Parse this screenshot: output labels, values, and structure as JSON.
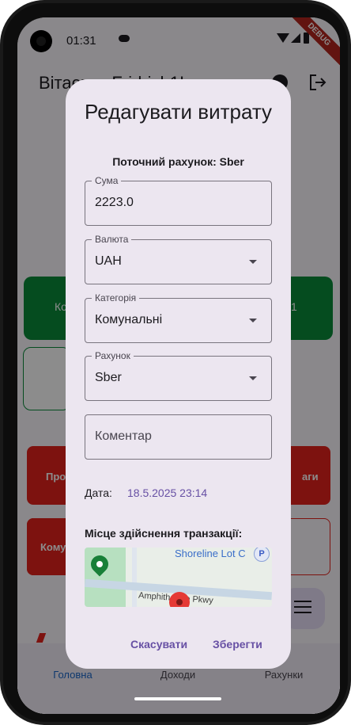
{
  "status_bar": {
    "time": "01:31",
    "debug_label": "DEBUG"
  },
  "app": {
    "title": "Вітаємо, Fridrich1!",
    "green_card": {
      "left_text": "Ко",
      "right_text": "1"
    },
    "red_card_1": {
      "left_text": "Про",
      "right_text": "аги"
    },
    "red_card_2": {
      "left_text": "Кому"
    }
  },
  "bottom_nav": {
    "items": [
      {
        "label": "Головна",
        "active": true
      },
      {
        "label": "Доходи",
        "active": false
      },
      {
        "label": "Рахунки",
        "active": false
      }
    ]
  },
  "dialog": {
    "title": "Редагувати витрату",
    "current_account": "Поточний рахунок: Sber",
    "fields": {
      "amount": {
        "label": "Сума",
        "value": "2223.0"
      },
      "currency": {
        "label": "Валюта",
        "value": "UAH"
      },
      "category": {
        "label": "Категорія",
        "value": "Комунальні"
      },
      "account": {
        "label": "Рахунок",
        "value": "Sber"
      },
      "comment": {
        "placeholder": "Коментар"
      }
    },
    "date_label": "Дата:",
    "date_value": "18.5.2025 23:14",
    "place_label": "Місце здійснення транзакції:",
    "map": {
      "poi_label": "Shoreline Lot C",
      "road_label": "Amphitheatre Pkwy",
      "parking_symbol": "P"
    },
    "cancel_label": "Скасувати",
    "save_label": "Зберегти"
  },
  "colors": {
    "accent": "#6750a4",
    "dialog_bg": "#ece6f0",
    "green": "#0a8a3a",
    "red": "#e3221c"
  }
}
